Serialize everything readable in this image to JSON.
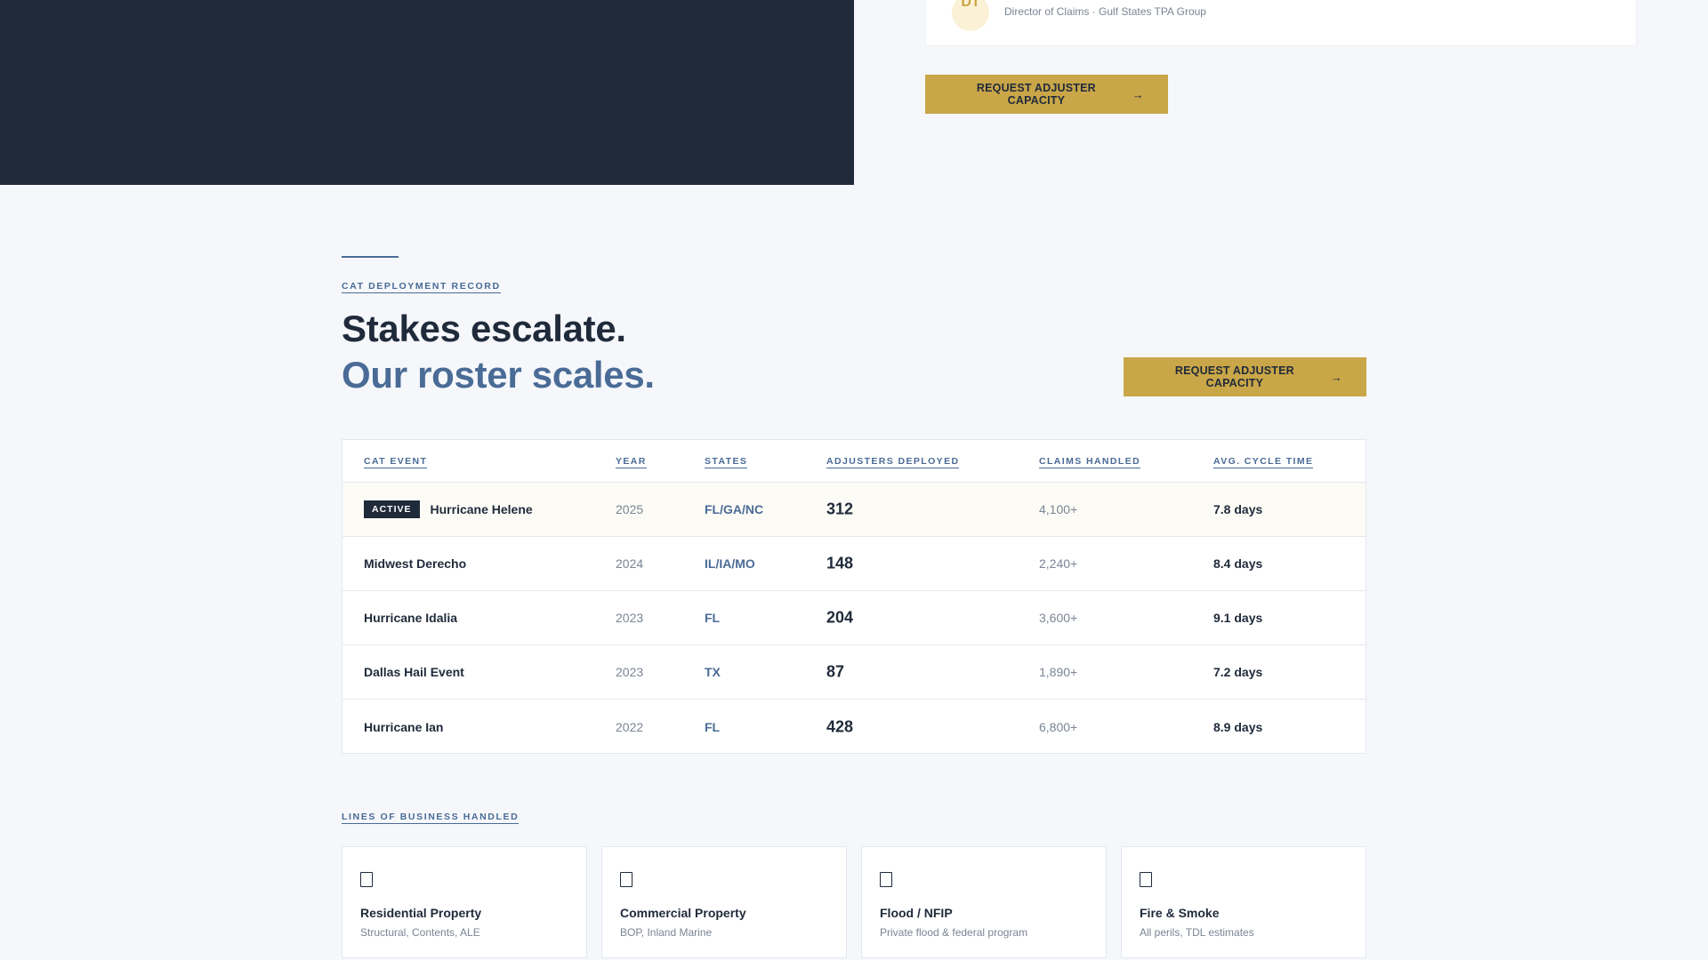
{
  "testimonial": {
    "avatar_initials": "DT",
    "attribution": "Director of Claims · Gulf States TPA Group"
  },
  "cta": {
    "label": "REQUEST ADJUSTER CAPACITY",
    "arrow": "→"
  },
  "cat_section": {
    "eyebrow": "CAT DEPLOYMENT RECORD",
    "headline_line1": "Stakes escalate.",
    "headline_line2": "Our roster scales.",
    "cta_label": "REQUEST ADJUSTER CAPACITY",
    "table": {
      "headers": [
        "CAT EVENT",
        "YEAR",
        "STATES",
        "ADJUSTERS DEPLOYED",
        "CLAIMS HANDLED",
        "AVG. CYCLE TIME"
      ],
      "rows": [
        {
          "badge": "ACTIVE",
          "event": "Hurricane Helene",
          "year": "2025",
          "states": "FL/GA/NC",
          "adjusters": "312",
          "claims": "4,100+",
          "cycle": "7.8 days"
        },
        {
          "event": "Midwest Derecho",
          "year": "2024",
          "states": "IL/IA/MO",
          "adjusters": "148",
          "claims": "2,240+",
          "cycle": "8.4 days"
        },
        {
          "event": "Hurricane Idalia",
          "year": "2023",
          "states": "FL",
          "adjusters": "204",
          "claims": "3,600+",
          "cycle": "9.1 days"
        },
        {
          "event": "Dallas Hail Event",
          "year": "2023",
          "states": "TX",
          "adjusters": "87",
          "claims": "1,890+",
          "cycle": "7.2 days"
        },
        {
          "event": "Hurricane Ian",
          "year": "2022",
          "states": "FL",
          "adjusters": "428",
          "claims": "6,800+",
          "cycle": "8.9 days"
        }
      ]
    }
  },
  "lob_section": {
    "eyebrow": "LINES OF BUSINESS HANDLED",
    "cards": [
      {
        "icon": "building-icon",
        "title": "Residential Property",
        "desc": "Structural, Contents, ALE"
      },
      {
        "icon": "building-icon",
        "title": "Commercial Property",
        "desc": "BOP, Inland Marine"
      },
      {
        "icon": "building-icon",
        "title": "Flood / NFIP",
        "desc": "Private flood & federal program"
      },
      {
        "icon": "building-icon",
        "title": "Fire & Smoke",
        "desc": "All perils, TDL estimates"
      }
    ]
  },
  "colors": {
    "navy": "#1f2a3a",
    "accent_blue": "#4a6b96",
    "gold": "#c9a648",
    "background": "#f5f7fb"
  }
}
